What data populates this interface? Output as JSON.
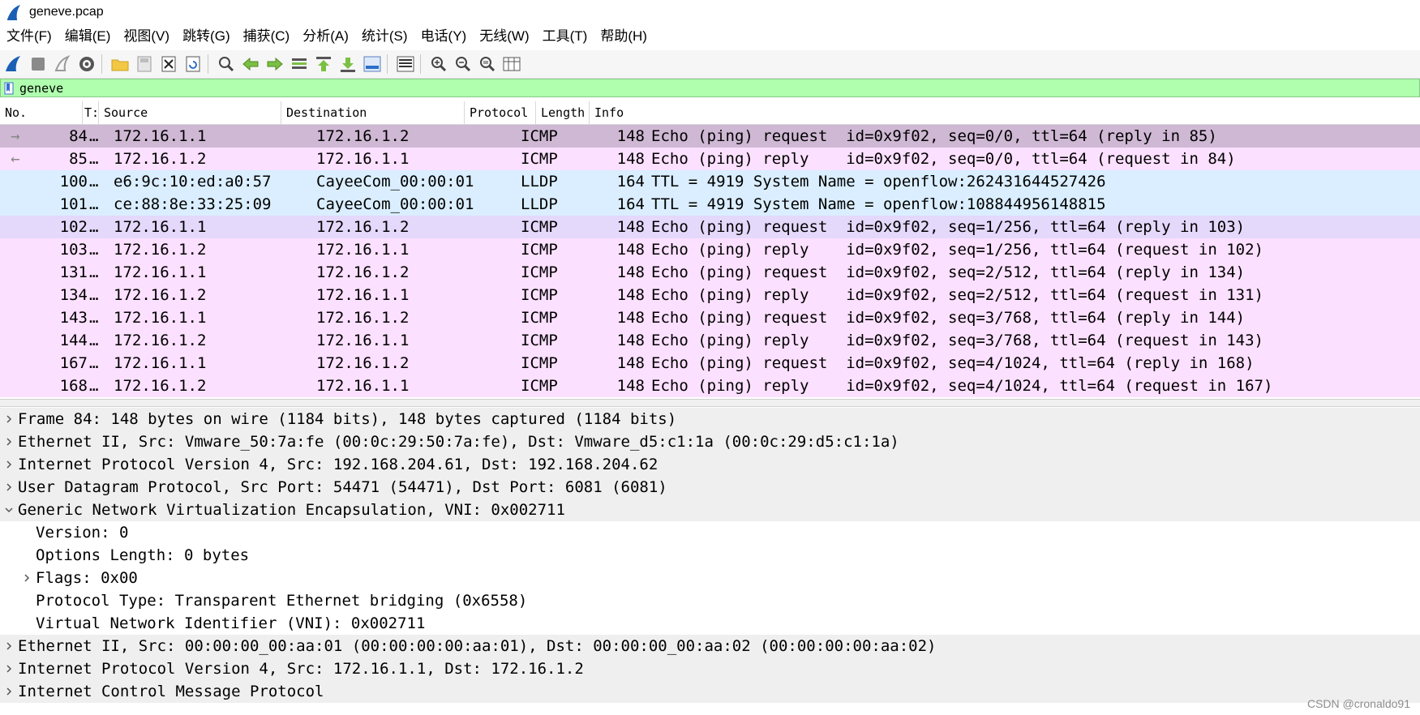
{
  "window": {
    "title": "geneve.pcap"
  },
  "menu": [
    "文件(F)",
    "编辑(E)",
    "视图(V)",
    "跳转(G)",
    "捕获(C)",
    "分析(A)",
    "统计(S)",
    "电话(Y)",
    "无线(W)",
    "工具(T)",
    "帮助(H)"
  ],
  "toolbar": {
    "groups": [
      [
        "shark-fin-start-icon",
        "stop-capture-icon",
        "restart-capture-icon",
        "capture-options-icon"
      ],
      [
        "open-file-icon",
        "save-file-icon",
        "close-file-icon",
        "reload-file-icon"
      ],
      [
        "find-packet-icon",
        "go-back-icon",
        "go-forward-icon",
        "go-to-packet-icon",
        "go-first-icon",
        "go-last-icon",
        "autoscroll-icon"
      ],
      [
        "colorize-icon"
      ],
      [
        "zoom-in-icon",
        "zoom-out-icon",
        "zoom-reset-icon",
        "resize-columns-icon"
      ]
    ]
  },
  "filter": {
    "value": "geneve"
  },
  "packet_list": {
    "headers": [
      "No.",
      "T:",
      "Source",
      "Destination",
      "Protocol",
      "Length",
      "Info"
    ],
    "rows": [
      {
        "no": "84",
        "t": "…",
        "src": "172.16.1.1",
        "dst": "172.16.1.2",
        "proto": "ICMP",
        "len": "148",
        "info": "Echo (ping) request  id=0x9f02, seq=0/0, ttl=64 (reply in 85)",
        "bg": "#cfb8d4",
        "mark": "→"
      },
      {
        "no": "85",
        "t": "…",
        "src": "172.16.1.2",
        "dst": "172.16.1.1",
        "proto": "ICMP",
        "len": "148",
        "info": "Echo (ping) reply    id=0x9f02, seq=0/0, ttl=64 (request in 84)",
        "bg": "#fce0ff",
        "mark": "←"
      },
      {
        "no": "100",
        "t": "…",
        "src": "e6:9c:10:ed:a0:57",
        "dst": "CayeeCom_00:00:01",
        "proto": "LLDP",
        "len": "164",
        "info": "TTL = 4919 System Name = openflow:262431644527426",
        "bg": "#daeeff",
        "mark": ""
      },
      {
        "no": "101",
        "t": "…",
        "src": "ce:88:8e:33:25:09",
        "dst": "CayeeCom_00:00:01",
        "proto": "LLDP",
        "len": "164",
        "info": "TTL = 4919 System Name = openflow:108844956148815",
        "bg": "#daeeff",
        "mark": ""
      },
      {
        "no": "102",
        "t": "…",
        "src": "172.16.1.1",
        "dst": "172.16.1.2",
        "proto": "ICMP",
        "len": "148",
        "info": "Echo (ping) request  id=0x9f02, seq=1/256, ttl=64 (reply in 103)",
        "bg": "#e4d8fb",
        "mark": ""
      },
      {
        "no": "103",
        "t": "…",
        "src": "172.16.1.2",
        "dst": "172.16.1.1",
        "proto": "ICMP",
        "len": "148",
        "info": "Echo (ping) reply    id=0x9f02, seq=1/256, ttl=64 (request in 102)",
        "bg": "#fce0ff",
        "mark": ""
      },
      {
        "no": "131",
        "t": "…",
        "src": "172.16.1.1",
        "dst": "172.16.1.2",
        "proto": "ICMP",
        "len": "148",
        "info": "Echo (ping) request  id=0x9f02, seq=2/512, ttl=64 (reply in 134)",
        "bg": "#fce0ff",
        "mark": ""
      },
      {
        "no": "134",
        "t": "…",
        "src": "172.16.1.2",
        "dst": "172.16.1.1",
        "proto": "ICMP",
        "len": "148",
        "info": "Echo (ping) reply    id=0x9f02, seq=2/512, ttl=64 (request in 131)",
        "bg": "#fce0ff",
        "mark": ""
      },
      {
        "no": "143",
        "t": "…",
        "src": "172.16.1.1",
        "dst": "172.16.1.2",
        "proto": "ICMP",
        "len": "148",
        "info": "Echo (ping) request  id=0x9f02, seq=3/768, ttl=64 (reply in 144)",
        "bg": "#fce0ff",
        "mark": ""
      },
      {
        "no": "144",
        "t": "…",
        "src": "172.16.1.2",
        "dst": "172.16.1.1",
        "proto": "ICMP",
        "len": "148",
        "info": "Echo (ping) reply    id=0x9f02, seq=3/768, ttl=64 (request in 143)",
        "bg": "#fce0ff",
        "mark": ""
      },
      {
        "no": "167",
        "t": "…",
        "src": "172.16.1.1",
        "dst": "172.16.1.2",
        "proto": "ICMP",
        "len": "148",
        "info": "Echo (ping) request  id=0x9f02, seq=4/1024, ttl=64 (reply in 168)",
        "bg": "#fce0ff",
        "mark": ""
      },
      {
        "no": "168",
        "t": "…",
        "src": "172.16.1.2",
        "dst": "172.16.1.1",
        "proto": "ICMP",
        "len": "148",
        "info": "Echo (ping) reply    id=0x9f02, seq=4/1024, ttl=64 (request in 167)",
        "bg": "#fce0ff",
        "mark": ""
      }
    ]
  },
  "details": [
    {
      "text": "Frame 84: 148 bytes on wire (1184 bits), 148 bytes captured (1184 bits)",
      "level": 0,
      "arrow": "right"
    },
    {
      "text": "Ethernet II, Src: Vmware_50:7a:fe (00:0c:29:50:7a:fe), Dst: Vmware_d5:c1:1a (00:0c:29:d5:c1:1a)",
      "level": 0,
      "arrow": "right"
    },
    {
      "text": "Internet Protocol Version 4, Src: 192.168.204.61, Dst: 192.168.204.62",
      "level": 0,
      "arrow": "right"
    },
    {
      "text": "User Datagram Protocol, Src Port: 54471 (54471), Dst Port: 6081 (6081)",
      "level": 0,
      "arrow": "right"
    },
    {
      "text": "Generic Network Virtualization Encapsulation, VNI: 0x002711",
      "level": 0,
      "arrow": "down"
    },
    {
      "text": "Version: 0",
      "level": 1,
      "arrow": "none"
    },
    {
      "text": "Options Length: 0 bytes",
      "level": 1,
      "arrow": "none"
    },
    {
      "text": "Flags: 0x00",
      "level": 1,
      "arrow": "right"
    },
    {
      "text": "Protocol Type: Transparent Ethernet bridging (0x6558)",
      "level": 1,
      "arrow": "none"
    },
    {
      "text": "Virtual Network Identifier (VNI): 0x002711",
      "level": 1,
      "arrow": "none"
    },
    {
      "text": "Ethernet II, Src: 00:00:00_00:aa:01 (00:00:00:00:aa:01), Dst: 00:00:00_00:aa:02 (00:00:00:00:aa:02)",
      "level": 0,
      "arrow": "right"
    },
    {
      "text": "Internet Protocol Version 4, Src: 172.16.1.1, Dst: 172.16.1.2",
      "level": 0,
      "arrow": "right"
    },
    {
      "text": "Internet Control Message Protocol",
      "level": 0,
      "arrow": "right"
    }
  ],
  "watermark": "CSDN @cronaldo91"
}
